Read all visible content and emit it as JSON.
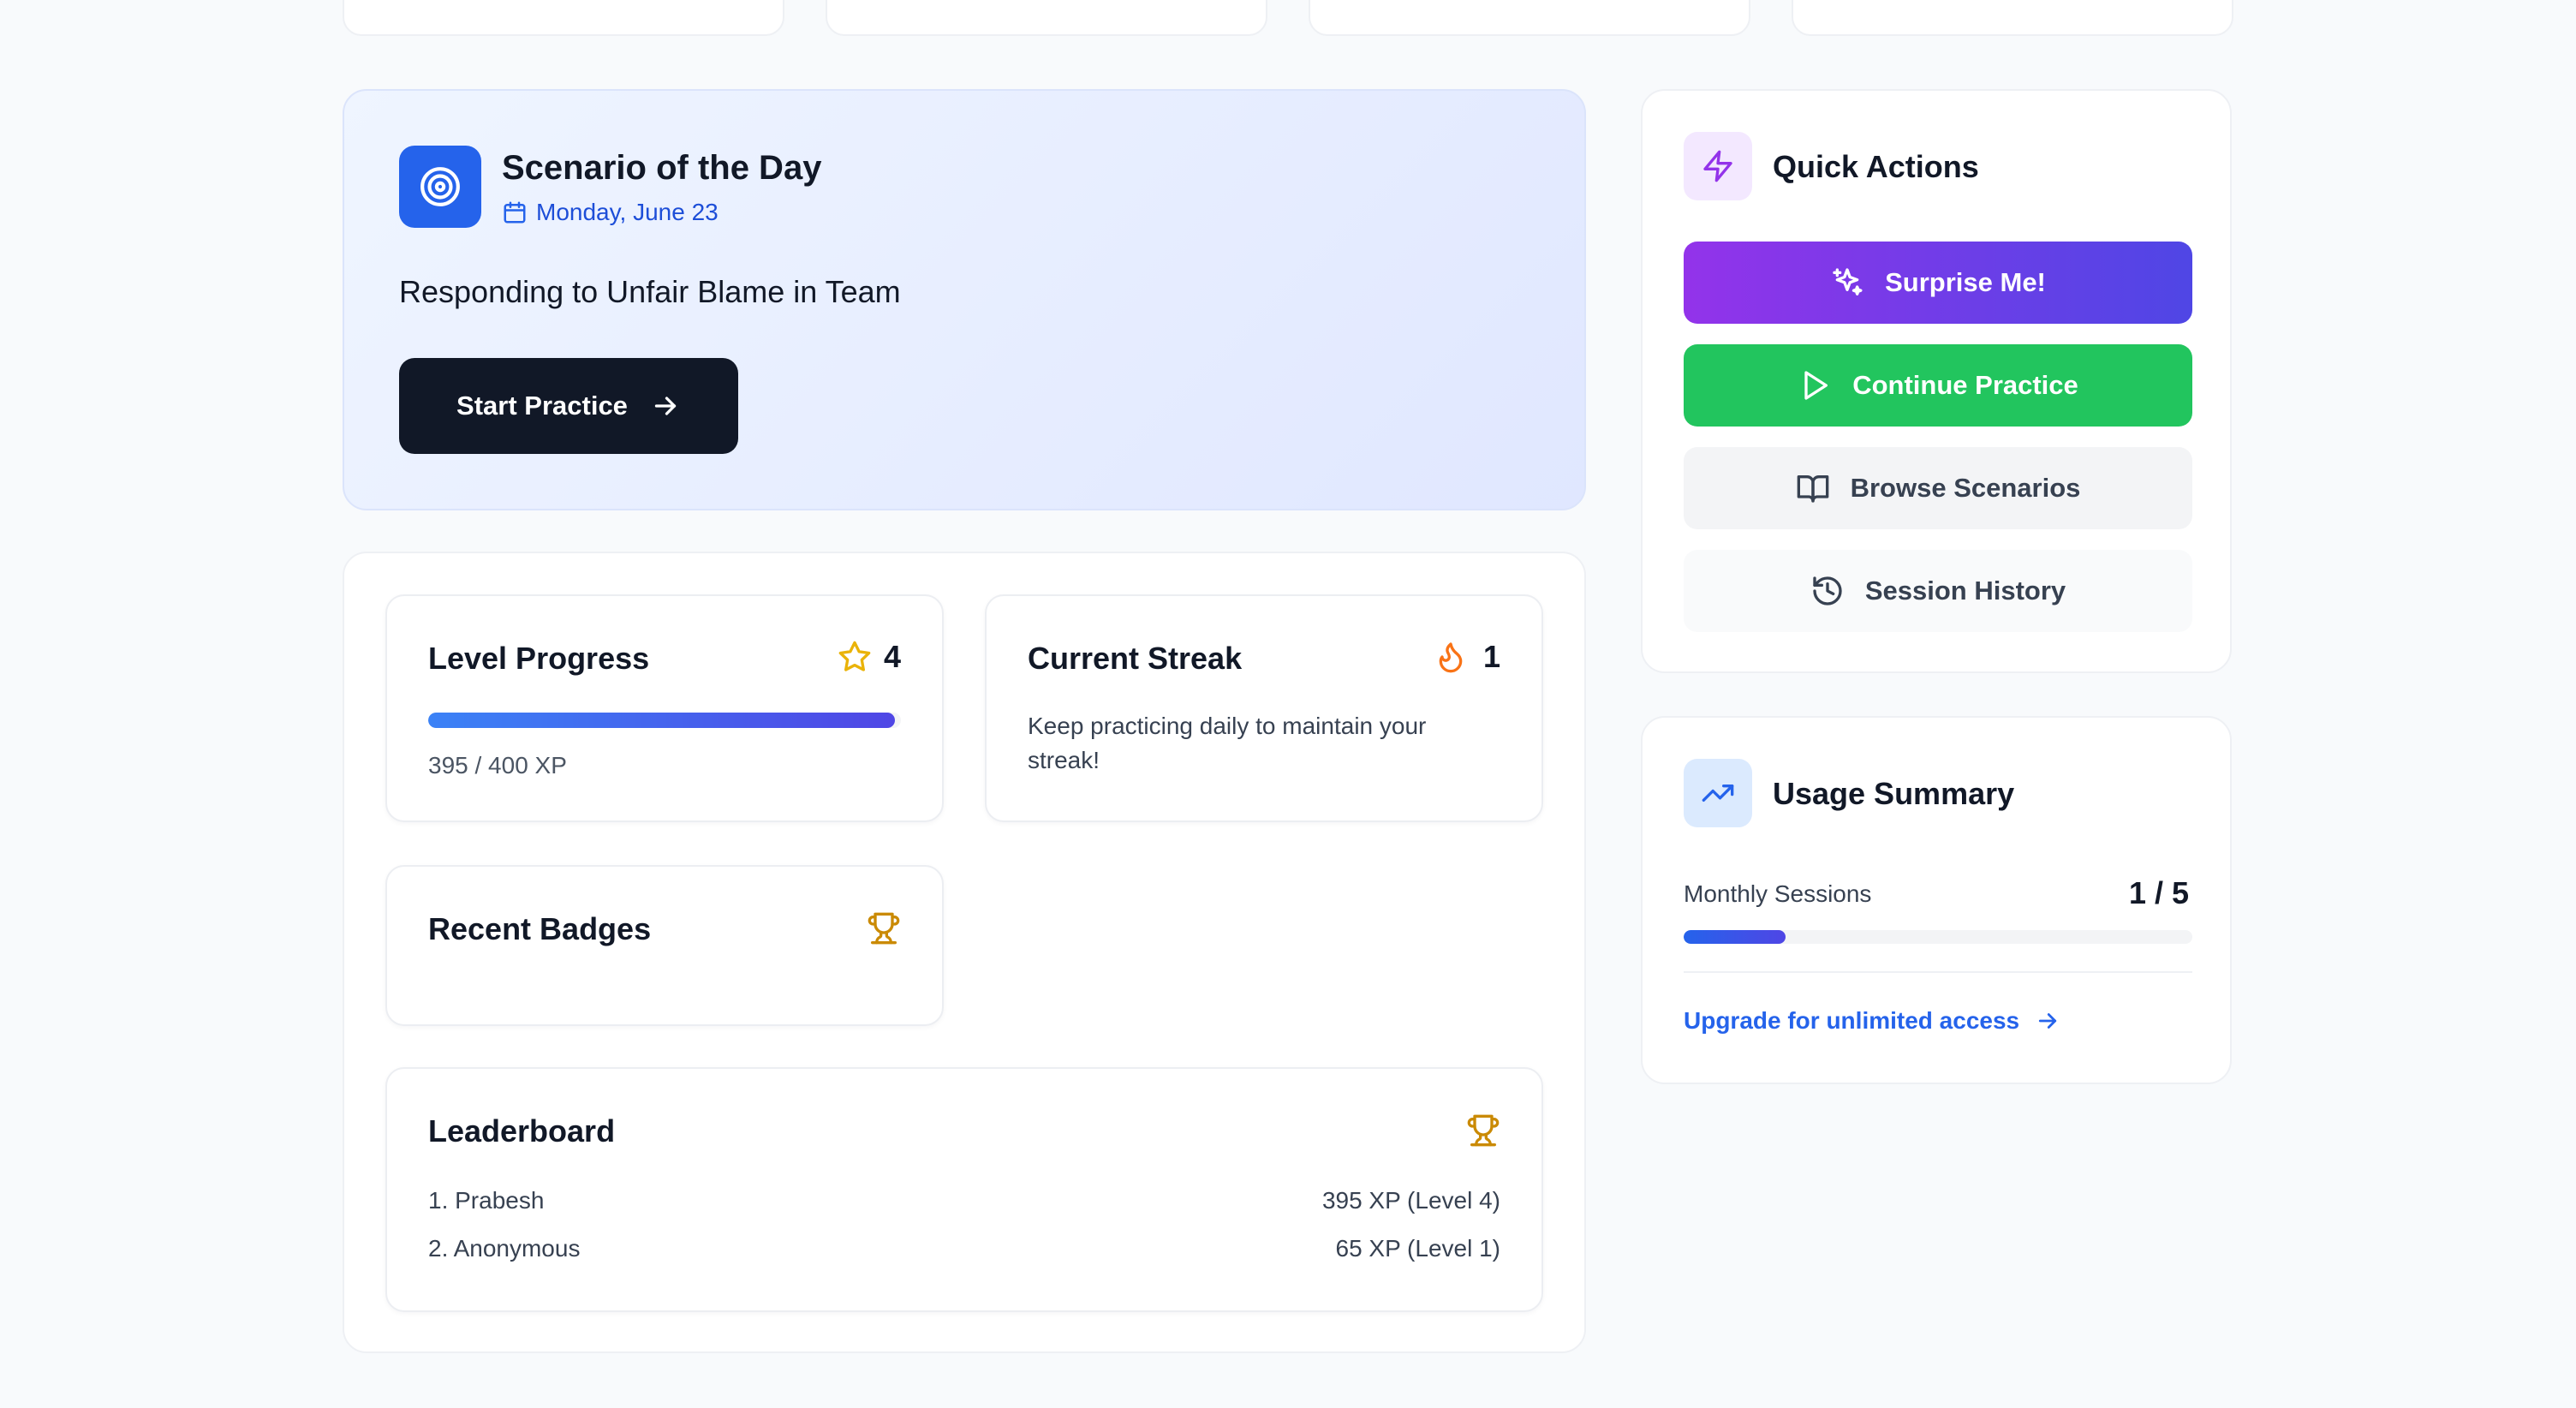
{
  "scenario": {
    "title": "Scenario of the Day",
    "date": "Monday, June 23",
    "name": "Responding to Unfair Blame in Team",
    "start_label": "Start Practice"
  },
  "quick_actions": {
    "title": "Quick Actions",
    "surprise_label": "Surprise Me!",
    "continue_label": "Continue Practice",
    "browse_label": "Browse Scenarios",
    "history_label": "Session History"
  },
  "level_progress": {
    "title": "Level Progress",
    "level": "4",
    "xp_text": "395 / 400 XP",
    "progress_fraction": 0.9875
  },
  "current_streak": {
    "title": "Current Streak",
    "count": "1",
    "message": "Keep practicing daily to maintain your streak!"
  },
  "recent_badges": {
    "title": "Recent Badges"
  },
  "leaderboard": {
    "title": "Leaderboard",
    "rows": [
      {
        "name": "1. Prabesh",
        "score": "395 XP (Level 4)"
      },
      {
        "name": "2. Anonymous",
        "score": "65 XP (Level 1)"
      }
    ]
  },
  "usage_summary": {
    "title": "Usage Summary",
    "monthly_label": "Monthly Sessions",
    "monthly_value": "1 / 5",
    "progress_fraction": 0.2,
    "upgrade_label": "Upgrade for unlimited access"
  },
  "colors": {
    "primary_blue": "#2563eb",
    "purple": "#9333ea",
    "indigo": "#4f46e5",
    "green": "#22c55e",
    "dark": "#111827",
    "star_yellow": "#eab308",
    "flame_orange": "#f97316",
    "trophy_yellow": "#ca8a04"
  }
}
